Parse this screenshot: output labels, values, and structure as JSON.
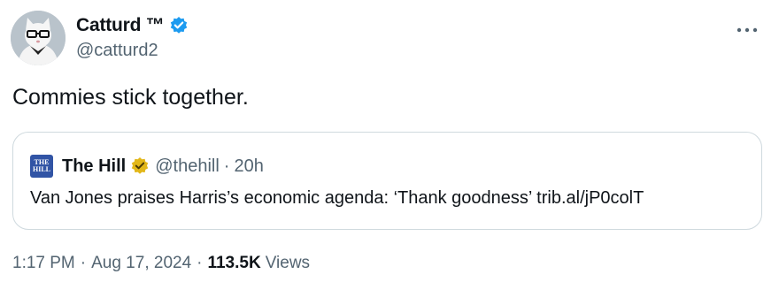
{
  "author": {
    "display_name": "Catturd ™",
    "handle": "@catturd2"
  },
  "tweet": {
    "text": "Commies stick together."
  },
  "quoted": {
    "logo_text": [
      "THE",
      "HILL"
    ],
    "display_name": "The Hill",
    "handle": "@thehill",
    "separator": "·",
    "time": "20h",
    "text": "Van Jones praises Harris’s economic agenda: ‘Thank goodness’ trib.al/jP0colT"
  },
  "meta": {
    "time": "1:17 PM",
    "separator": "·",
    "date": "Aug 17, 2024",
    "views_count": "113.5K",
    "views_label": "Views"
  },
  "colors": {
    "verified_blue": "#1d9bf0",
    "verified_gold": "#e2b719",
    "hill_blue": "#3154a5"
  },
  "icons": {
    "verified": "verified-badge-icon",
    "gold": "gold-verified-badge-icon",
    "more": "more-dots-icon"
  }
}
